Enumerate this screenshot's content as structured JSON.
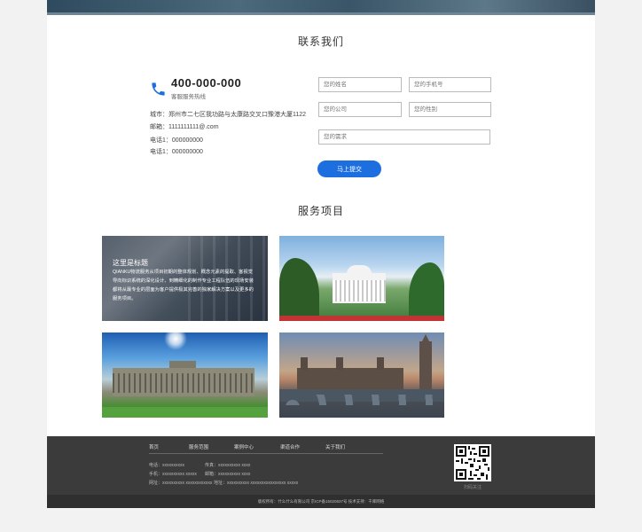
{
  "contact": {
    "title": "联系我们",
    "hotline_number": "400-000-000",
    "hotline_label": "客服服务热线",
    "city_line": "城市：郑州市二七区我功路与太康路交叉口豫港大厦1122",
    "email_line": "邮箱：1111111111@.com",
    "phone_line_1": "电话1：000000000",
    "phone_line_2": "电话1：000000000",
    "form": {
      "name_placeholder": "您的姓名",
      "phone_placeholder": "您的手机号",
      "company_placeholder": "您的公司",
      "gender_placeholder": "您的性别",
      "demand_placeholder": "您的需求",
      "submit_label": "马上提交"
    }
  },
  "services": {
    "title": "服务项目",
    "card1_title": "这里是标题",
    "card1_desc": "QIANKU物流服务从项目初期的整体规划、概念元素的提取、客视觉导向标识系统的深化设计、到精细化的制作专业工程队伍的现场安装都将从最专业的层面为客户提供极其完善的独家解决方案以及更多的服务项目。"
  },
  "footer": {
    "nav": [
      "首页",
      "服务范围",
      "案例中心",
      "渠道合作",
      "关于我们"
    ],
    "phone_label": "电话：",
    "phone_value": "xxxxxxxxxx",
    "fax_label": "传真：",
    "fax_value": "xxxxxxxxxx xxxx",
    "mobile_label": "手机：",
    "mobile_value": "xxxxxxxxxx xxxxx",
    "email_label": "邮箱：",
    "email_value": "xxxxxxxxxx xxxx",
    "website_label": "网址：",
    "website_value": "xxxxxxxxxx xxxxxxxxxxxx",
    "address_label": "地址：",
    "address_value": "xxxxxxxxxx xxxxxxxxxxxxxxxx xxxxx",
    "qr_label": "扫码关注",
    "copyright": "版权所有：什么什么有限公司 京ICP备15020837号 技术支持：千库网络"
  }
}
